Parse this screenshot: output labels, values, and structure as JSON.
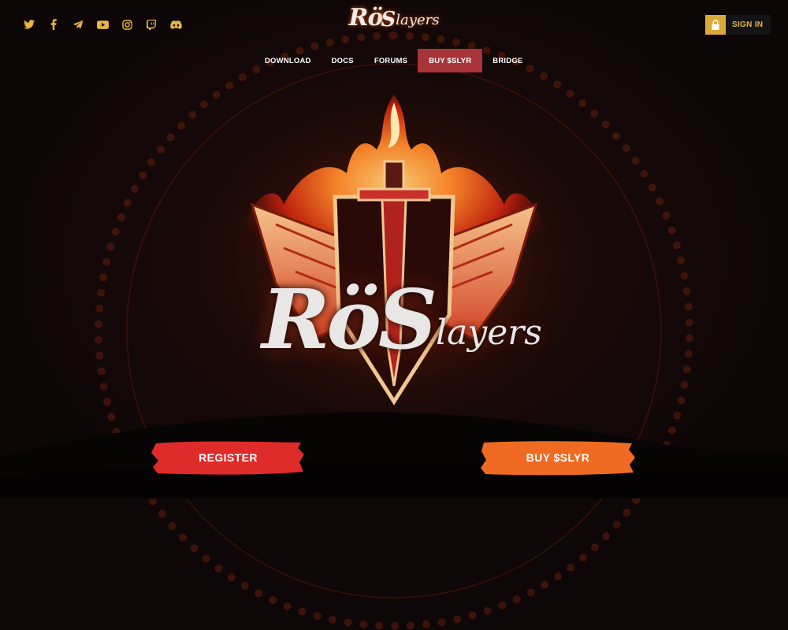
{
  "social": [
    {
      "name": "twitter-icon",
      "glyph": "🐦"
    },
    {
      "name": "facebook-icon",
      "glyph": "f"
    },
    {
      "name": "telegram-icon",
      "glyph": "➤"
    },
    {
      "name": "youtube-icon",
      "glyph": "▶"
    },
    {
      "name": "instagram-icon",
      "glyph": "◎"
    },
    {
      "name": "twitch-icon",
      "glyph": "▣"
    },
    {
      "name": "discord-icon",
      "glyph": "◉"
    }
  ],
  "brand": {
    "logo_main": "Rö",
    "logo_tail": "layers",
    "logo_s": "S",
    "hero_main": "RöS",
    "hero_tail": "layers"
  },
  "header": {
    "sign_in_label": "SIGN IN"
  },
  "nav": {
    "items": [
      {
        "label": "DOWNLOAD",
        "active": false
      },
      {
        "label": "DOCS",
        "active": false
      },
      {
        "label": "FORUMS",
        "active": false
      },
      {
        "label": "BUY $SLYR",
        "active": true
      },
      {
        "label": "BRIDGE",
        "active": false
      }
    ]
  },
  "cta": {
    "register_label": "REGISTER",
    "buy_label": "BUY $SLYR"
  },
  "colors": {
    "accent_gold": "#e8b442",
    "nav_active": "#a8343a",
    "register": "#e02b2b",
    "buy": "#ef6a22"
  }
}
